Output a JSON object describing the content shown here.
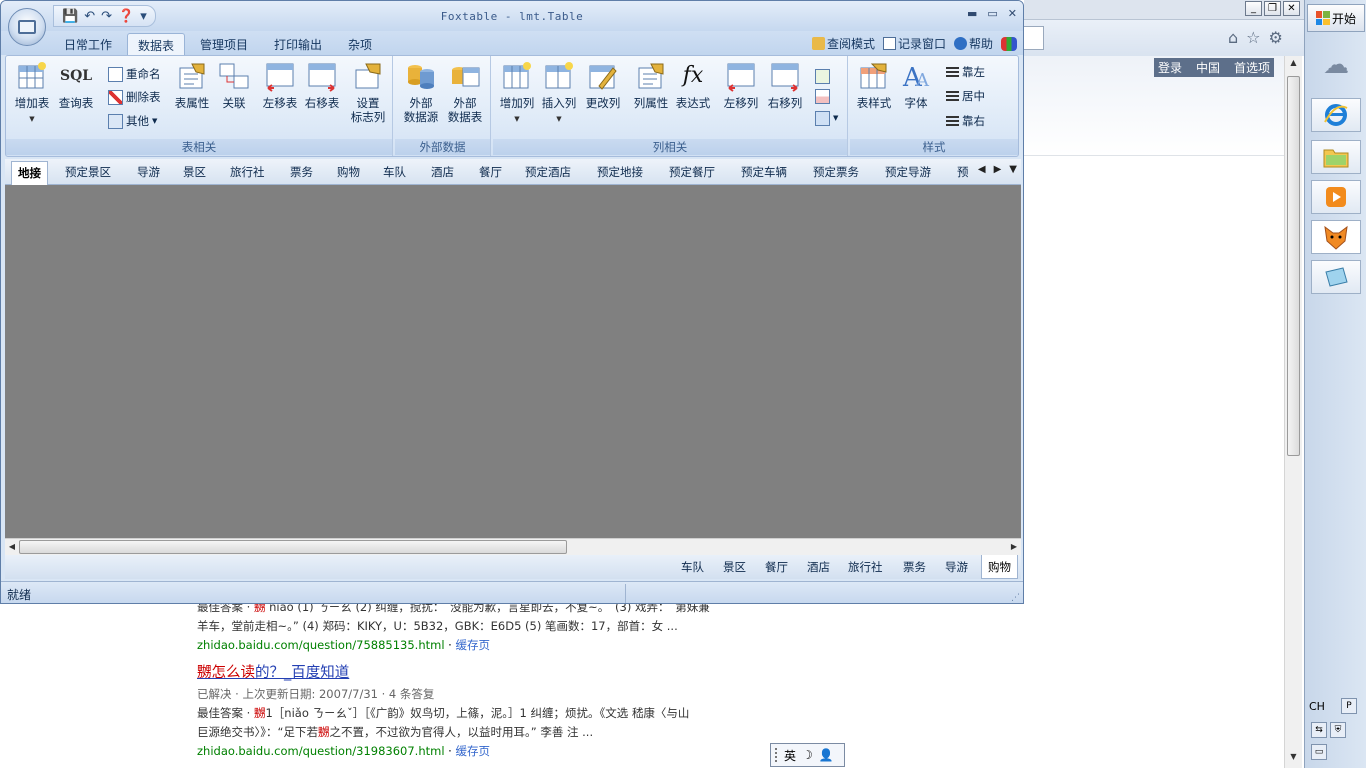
{
  "app": {
    "title": "Foxtable - lmt.Table",
    "qat_icons": [
      "save-icon",
      "undo-icon",
      "redo-icon",
      "help-icon",
      "customize-icon"
    ],
    "menu_tabs": [
      "日常工作",
      "数据表",
      "管理项目",
      "打印输出",
      "杂项"
    ],
    "active_tab": "数据表",
    "right_links": [
      "查阅模式",
      "记录窗口",
      "帮助"
    ]
  },
  "ribbon": {
    "group_table": {
      "label": "表相关",
      "add_table": "增加表",
      "query_table": "查询表",
      "sql": "SQL",
      "rename": "重命名",
      "delete_table": "删除表",
      "other": "其他",
      "table_props": "表属性",
      "relation": "关联",
      "move_left": "左移表",
      "move_right": "右移表",
      "set_flag_1": "设置",
      "set_flag_2": "标志列"
    },
    "group_external": {
      "label": "外部数据",
      "ext_source_1": "外部",
      "ext_source_2": "数据源",
      "ext_table_1": "外部",
      "ext_table_2": "数据表"
    },
    "group_column": {
      "label": "列相关",
      "add_col": "增加列",
      "insert_col": "插入列",
      "change_col": "更改列",
      "col_props": "列属性",
      "expression": "表达式",
      "fx": "fx",
      "move_left": "左移列",
      "move_right": "右移列"
    },
    "group_style": {
      "label": "样式",
      "table_style": "表样式",
      "font": "字体",
      "align_left": "靠左",
      "align_center": "居中",
      "align_right": "靠右"
    }
  },
  "sheet_tabs": [
    "地接",
    "预定景区",
    "导游",
    "景区",
    "旅行社",
    "票务",
    "购物",
    "车队",
    "酒店",
    "餐厅",
    "预定酒店",
    "预定地接",
    "预定餐厅",
    "预定车辆",
    "预定票务",
    "预定导游",
    "预"
  ],
  "active_sheet": "地接",
  "bottom_tabs": [
    "车队",
    "景区",
    "餐厅",
    "酒店",
    "旅行社",
    "票务",
    "导游",
    "购物"
  ],
  "active_bottom": "购物",
  "status": "就绪",
  "browser": {
    "links": [
      "登录",
      "中国",
      "首选项"
    ],
    "result1": {
      "snippet1_a": "最佳答案 · ",
      "snippet1_hl": "嬲",
      "snippet1_b": " niǎo (1) ㄋㄧㄠ (2) 纠缠，搅扰：　没能为歉，言星即去，不复~。　(3) 戏弄：　第妹兼",
      "snippet2": "羊车，堂前走相~。” (4) 郑码：KIKY，U：5B32，GBK：E6D5 (5) 笔画数：17，部首：女 ...",
      "url": "zhidao.baidu.com/question/75885135.html",
      "cache": "缓存页"
    },
    "result2": {
      "title_hl": "嬲怎么读",
      "title_rest": "的？_百度知道",
      "meta": "已解决 · 上次更新日期: 2007/7/31 · 4 条答复",
      "snippet1_a": "最佳答案 · ",
      "snippet1_hl": "嬲",
      "snippet1_b": "1［niǎo ㄋㄧㄠˇ］［《广韵》奴鸟切，上篠，泥。］1 纠缠；烦扰。《文选 嵇康〈与山",
      "snippet2_a": "巨源绝交书〉》：“足下若",
      "snippet2_hl": "嬲",
      "snippet2_b": "之不置，不过欲为官得人，以益时用耳。” 李善 注 ...",
      "url": "zhidao.baidu.com/question/31983607.html",
      "cache": "缓存页"
    }
  },
  "taskbar": {
    "start": "开始",
    "lang": "CH",
    "icons": [
      "cloud-icon",
      "ie-icon",
      "folder-icon",
      "media-player-icon",
      "foxtable-icon",
      "notebook-icon"
    ]
  },
  "ime": {
    "mode": "英"
  },
  "colors": {
    "grid_bg": "#808080",
    "ribbon_bg": "#dde9f7",
    "accent": "#15365f",
    "link": "#2440b3",
    "url_green": "#008000",
    "highlight": "#cc0000"
  }
}
